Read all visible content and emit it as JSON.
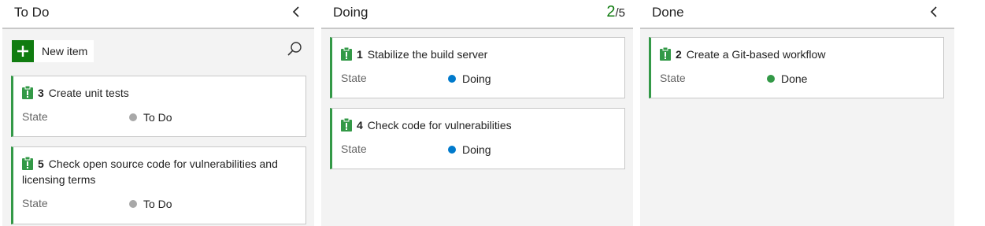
{
  "columns": {
    "todo": {
      "title": "To Do",
      "new_item_label": "New item",
      "cards": [
        {
          "id": "3",
          "title": "Create unit tests",
          "field_label": "State",
          "state": "To Do",
          "state_color": "#a8a8a8"
        },
        {
          "id": "5",
          "title": "Check open source code for vulnerabilities and licensing terms",
          "field_label": "State",
          "state": "To Do",
          "state_color": "#a8a8a8"
        }
      ]
    },
    "doing": {
      "title": "Doing",
      "wip_count": "2",
      "wip_limit": "/5",
      "cards": [
        {
          "id": "1",
          "title": "Stabilize the build server",
          "field_label": "State",
          "state": "Doing",
          "state_color": "#007acc"
        },
        {
          "id": "4",
          "title": "Check code for vulnerabilities",
          "field_label": "State",
          "state": "Doing",
          "state_color": "#007acc"
        }
      ]
    },
    "done": {
      "title": "Done",
      "cards": [
        {
          "id": "2",
          "title": "Create a Git-based workflow",
          "field_label": "State",
          "state": "Done",
          "state_color": "#339947"
        }
      ]
    }
  },
  "colors": {
    "card_accent": "#339947",
    "add_button": "#107c10",
    "wip_count": "#107c10"
  },
  "icons": {
    "collapse": "chevron-left-icon",
    "search": "search-icon",
    "add": "plus-icon",
    "work_item": "clipboard-icon"
  }
}
